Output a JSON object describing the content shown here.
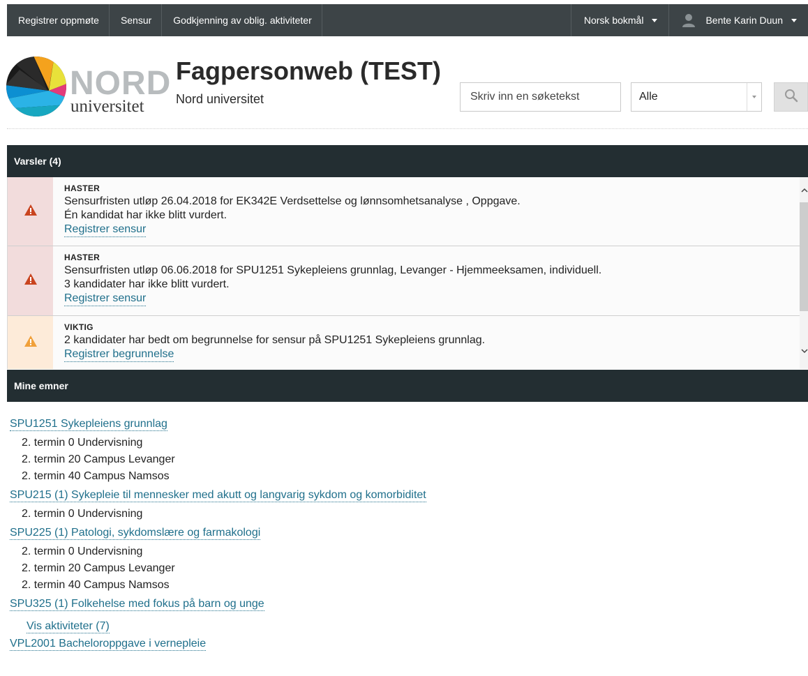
{
  "topnav": {
    "items": [
      "Registrer oppmøte",
      "Sensur",
      "Godkjenning av oblig. aktiviteter"
    ],
    "language": "Norsk bokmål",
    "user": "Bente Karin Duun"
  },
  "header": {
    "logo_word": "NORD",
    "logo_sub": "universitet",
    "title": "Fagpersonweb (TEST)",
    "subtitle": "Nord universitet",
    "search_placeholder": "Skriv inn en søketekst",
    "scope_value": "Alle"
  },
  "alerts": {
    "heading": "Varsler (4)",
    "items": [
      {
        "level": "HASTER",
        "line1": "Sensurfristen utløp 26.04.2018 for EK342E Verdsettelse og lønnsomhetsanalyse , Oppgave.",
        "line2": "Én kandidat har ikke blitt vurdert.",
        "link": "Registrer sensur"
      },
      {
        "level": "HASTER",
        "line1": "Sensurfristen utløp 06.06.2018 for SPU1251 Sykepleiens grunnlag, Levanger - Hjemmeeksamen, individuell.",
        "line2": "3 kandidater har ikke blitt vurdert.",
        "link": "Registrer sensur"
      },
      {
        "level": "VIKTIG",
        "line1": "2 kandidater har bedt om begrunnelse for sensur på SPU1251 Sykepleiens grunnlag.",
        "link": "Registrer begrunnelse"
      }
    ]
  },
  "courses": {
    "heading": "Mine emner",
    "items": [
      {
        "title": "SPU1251 Sykepleiens grunnlag",
        "terms": [
          "2. termin 0 Undervisning",
          "2. termin 20 Campus Levanger",
          "2. termin 40 Campus Namsos"
        ]
      },
      {
        "title": "SPU215 (1) Sykepleie til mennesker med akutt og langvarig sykdom og komorbiditet",
        "terms": [
          "2. termin 0 Undervisning"
        ]
      },
      {
        "title": "SPU225 (1) Patologi, sykdomslære og farmakologi",
        "terms": [
          "2. termin 0 Undervisning",
          "2. termin 20 Campus Levanger",
          "2. termin 40 Campus Namsos"
        ]
      },
      {
        "title": "SPU325 (1) Folkehelse med fokus på barn og unge",
        "activities_link": "Vis aktiviteter (7)"
      },
      {
        "title": "VPL2001 Bacheloroppgave i vernepleie"
      }
    ]
  },
  "colors": {
    "nav_bg": "#3d4447",
    "panel_head_bg": "#232e32",
    "link": "#1f6f8b",
    "urgent_icon": "#c9441f",
    "important_icon": "#f0a03a"
  }
}
